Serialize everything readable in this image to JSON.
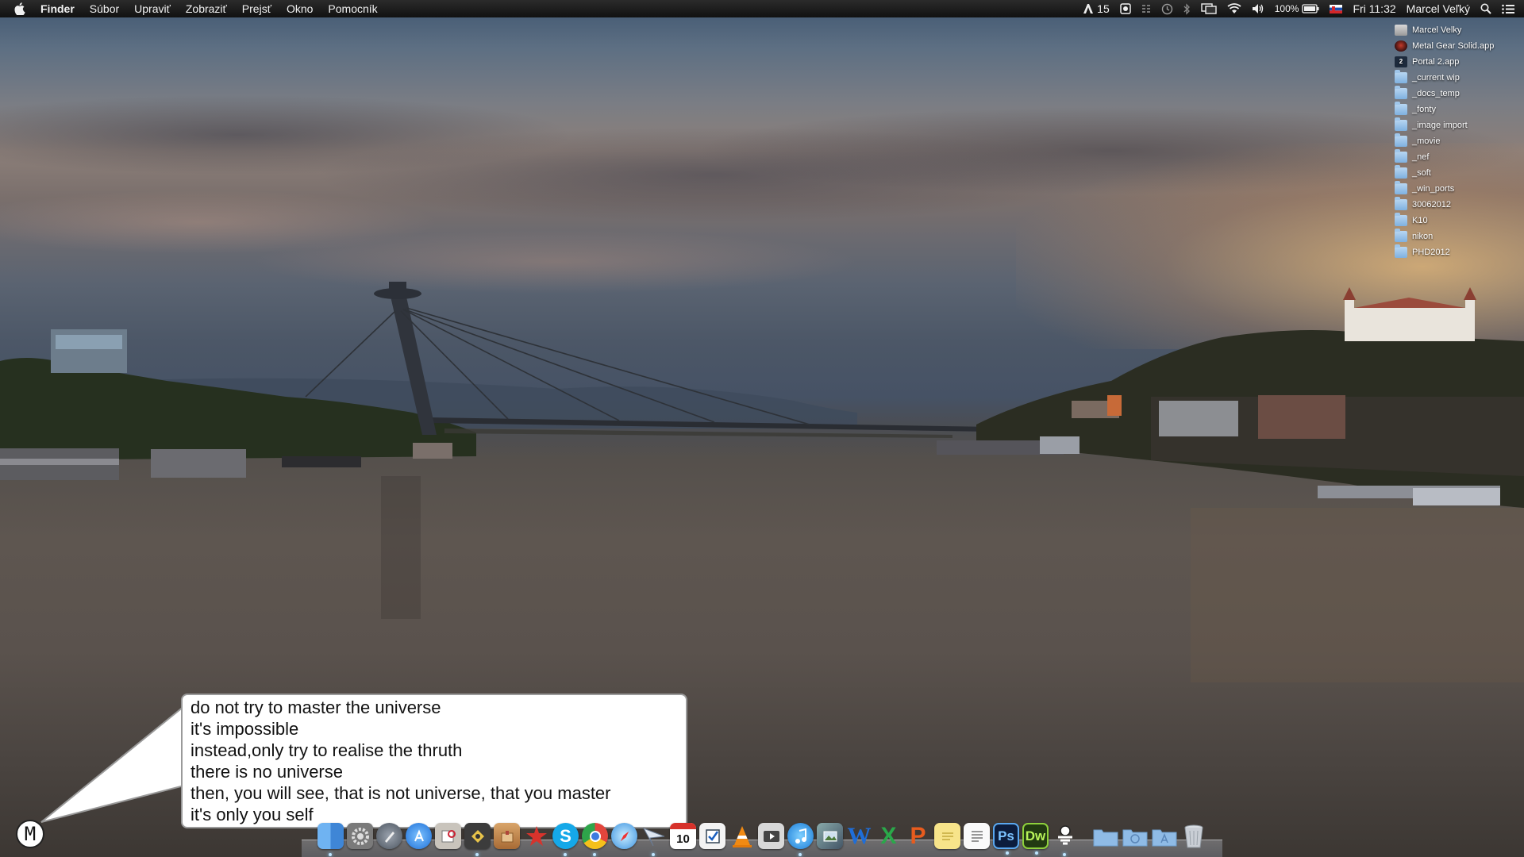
{
  "menubar": {
    "app_name": "Finder",
    "menus": [
      "Súbor",
      "Upraviť",
      "Zobraziť",
      "Prejsť",
      "Okno",
      "Pomocník"
    ],
    "status": {
      "adobe_count": "15",
      "battery": "100%",
      "clock": "Fri 11:32",
      "user": "Marcel Veľký"
    }
  },
  "desktop_items": [
    {
      "label": "Marcel Velky",
      "icon": "user-icon"
    },
    {
      "label": "Metal Gear Solid.app",
      "icon": "app-icon"
    },
    {
      "label": "Portal 2.app",
      "icon": "app-icon"
    },
    {
      "label": "_current wip",
      "icon": "folder-icon"
    },
    {
      "label": "_docs_temp",
      "icon": "folder-icon"
    },
    {
      "label": "_fonty",
      "icon": "folder-icon"
    },
    {
      "label": "_image import",
      "icon": "folder-icon"
    },
    {
      "label": "_movie",
      "icon": "folder-icon"
    },
    {
      "label": "_nef",
      "icon": "folder-icon"
    },
    {
      "label": "_soft",
      "icon": "folder-icon"
    },
    {
      "label": "_win_ports",
      "icon": "folder-icon"
    },
    {
      "label": "30062012",
      "icon": "folder-icon"
    },
    {
      "label": "K10",
      "icon": "folder-icon"
    },
    {
      "label": "nikon",
      "icon": "folder-icon"
    },
    {
      "label": "PHD2012",
      "icon": "folder-icon"
    }
  ],
  "portal_icon_text": "2",
  "bubble": {
    "lines": [
      "do not try to master the universe",
      "it's impossible",
      "instead,only try to realise the thruth",
      "there is no universe",
      "then, you will see, that is not universe, that you master",
      "it's only you self"
    ],
    "avatar_letter": "M"
  },
  "dock": {
    "calendar_day": "10",
    "word_letter": "W",
    "excel_letter": "X",
    "powerpoint_letter": "P",
    "photoshop_label": "Ps",
    "dreamweaver_label": "Dw",
    "skype_letter": "S"
  },
  "colors": {
    "menubar_bg": "#1a1a1a",
    "bubble_bg": "#ffffff",
    "folder_blue": "#8fbbe6"
  }
}
